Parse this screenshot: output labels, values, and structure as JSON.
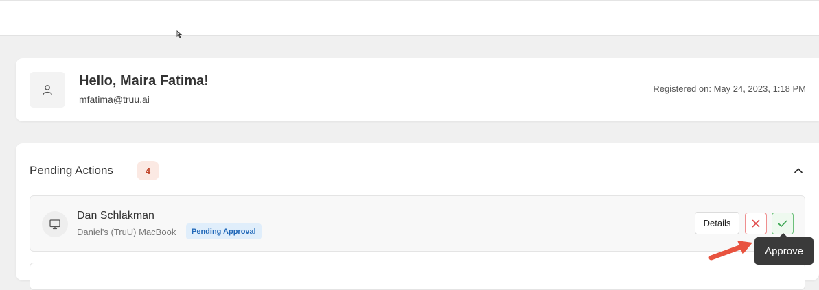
{
  "icons": {
    "avatar": "user-icon",
    "device": "monitor-icon",
    "collapse": "chevron-up-icon",
    "reject": "close-icon",
    "approve": "check-icon",
    "annotation": "arrow-icon"
  },
  "colors": {
    "page_bg": "#f0f0f0",
    "count_badge_bg": "#fbe9e3",
    "count_badge_text": "#c0452a",
    "status_badge_bg": "#e0eefb",
    "status_badge_text": "#2168b8",
    "reject": "#e04848",
    "approve": "#3aa551",
    "annotation_arrow": "#e8533f"
  },
  "profile": {
    "greeting": "Hello, Maira Fatima!",
    "email": "mfatima@truu.ai",
    "registered": "Registered on: May 24, 2023, 1:18 PM"
  },
  "pending": {
    "title": "Pending Actions",
    "count": "4",
    "items": [
      {
        "name": "Dan Schlakman",
        "device": "Daniel's (TruU) MacBook",
        "status": "Pending Approval",
        "details_label": "Details"
      }
    ]
  },
  "tooltip": {
    "text": "Approve"
  }
}
